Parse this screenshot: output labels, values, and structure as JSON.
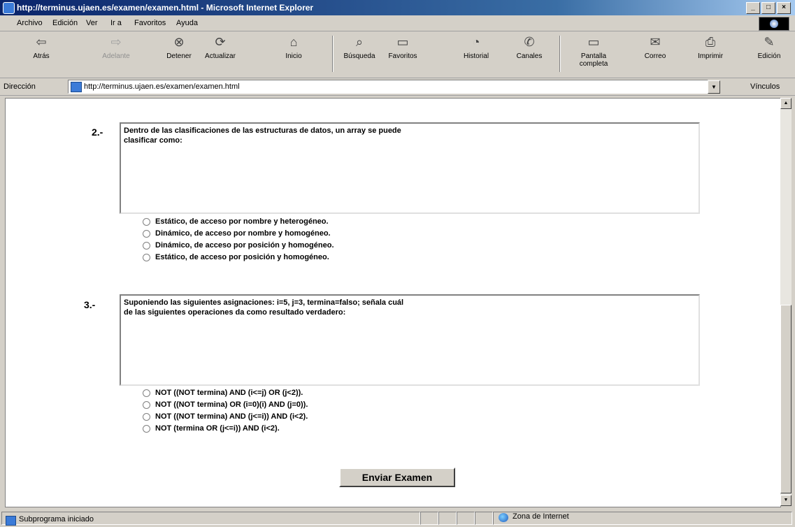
{
  "window": {
    "title": "http://terminus.ujaen.es/examen/examen.html - Microsoft Internet Explorer",
    "controls": [
      "_",
      "□",
      "×"
    ]
  },
  "menu": [
    "Archivo",
    "Edición",
    "Ver",
    "Ir a",
    "Favoritos",
    "Ayuda"
  ],
  "toolbar": {
    "buttons": [
      {
        "label": "Atrás",
        "icon": "back-arrow-icon",
        "glyph": "⇦"
      },
      {
        "label": "Adelante",
        "icon": "forward-arrow-icon",
        "glyph": "⇨"
      },
      {
        "label": "Detener",
        "icon": "stop-icon",
        "glyph": "⊗"
      },
      {
        "label": "Actualizar",
        "icon": "refresh-icon",
        "glyph": "⟳"
      },
      {
        "label": "Inicio",
        "icon": "home-icon",
        "glyph": "⌂"
      },
      {
        "label": "Búsqueda",
        "icon": "search-icon",
        "glyph": "⌕"
      },
      {
        "label": "Favoritos",
        "icon": "favorites-icon",
        "glyph": "▭"
      },
      {
        "label": "Historial",
        "icon": "history-icon",
        "glyph": "◔"
      },
      {
        "label": "Canales",
        "icon": "channels-icon",
        "glyph": "✆"
      },
      {
        "label": "Pantalla completa",
        "icon": "fullscreen-icon",
        "glyph": "▭"
      },
      {
        "label": "Correo",
        "icon": "mail-icon",
        "glyph": "✉"
      },
      {
        "label": "Imprimir",
        "icon": "print-icon",
        "glyph": "⎙"
      },
      {
        "label": "Edición",
        "icon": "edit-icon",
        "glyph": "✎"
      }
    ]
  },
  "address": {
    "label": "Dirección",
    "url": "http://terminus.ujaen.es/examen/examen.html",
    "links_label": "Vínculos"
  },
  "questions": [
    {
      "number": "2.-",
      "text": "Dentro de las clasificaciones de las estructuras de datos, un array se puede\nclasificar como:",
      "options": [
        "Estático, de acceso por nombre y heterogéneo.",
        "Dinámico, de acceso por nombre y homogéneo.",
        "Dinámico, de acceso por posición y homogéneo.",
        "Estático, de acceso por posición y homogéneo."
      ]
    },
    {
      "number": "3.-",
      "text": "Suponiendo las siguientes asignaciones: i=5, j=3, termina=falso; señala cuál\nde las siguientes operaciones da como resultado verdadero:",
      "options": [
        "NOT ((NOT termina) AND (i<=j) OR (j<2)).",
        "NOT ((NOT termina) OR (i=0)(i) AND (j=0)).",
        "NOT ((NOT termina) AND (j<=i)) AND (i<2).",
        "NOT (termina OR (j<=i)) AND (i<2)."
      ]
    }
  ],
  "submit_label": "Enviar Examen",
  "status": {
    "left": "Subprograma iniciado",
    "zone": "Zona de Internet"
  }
}
